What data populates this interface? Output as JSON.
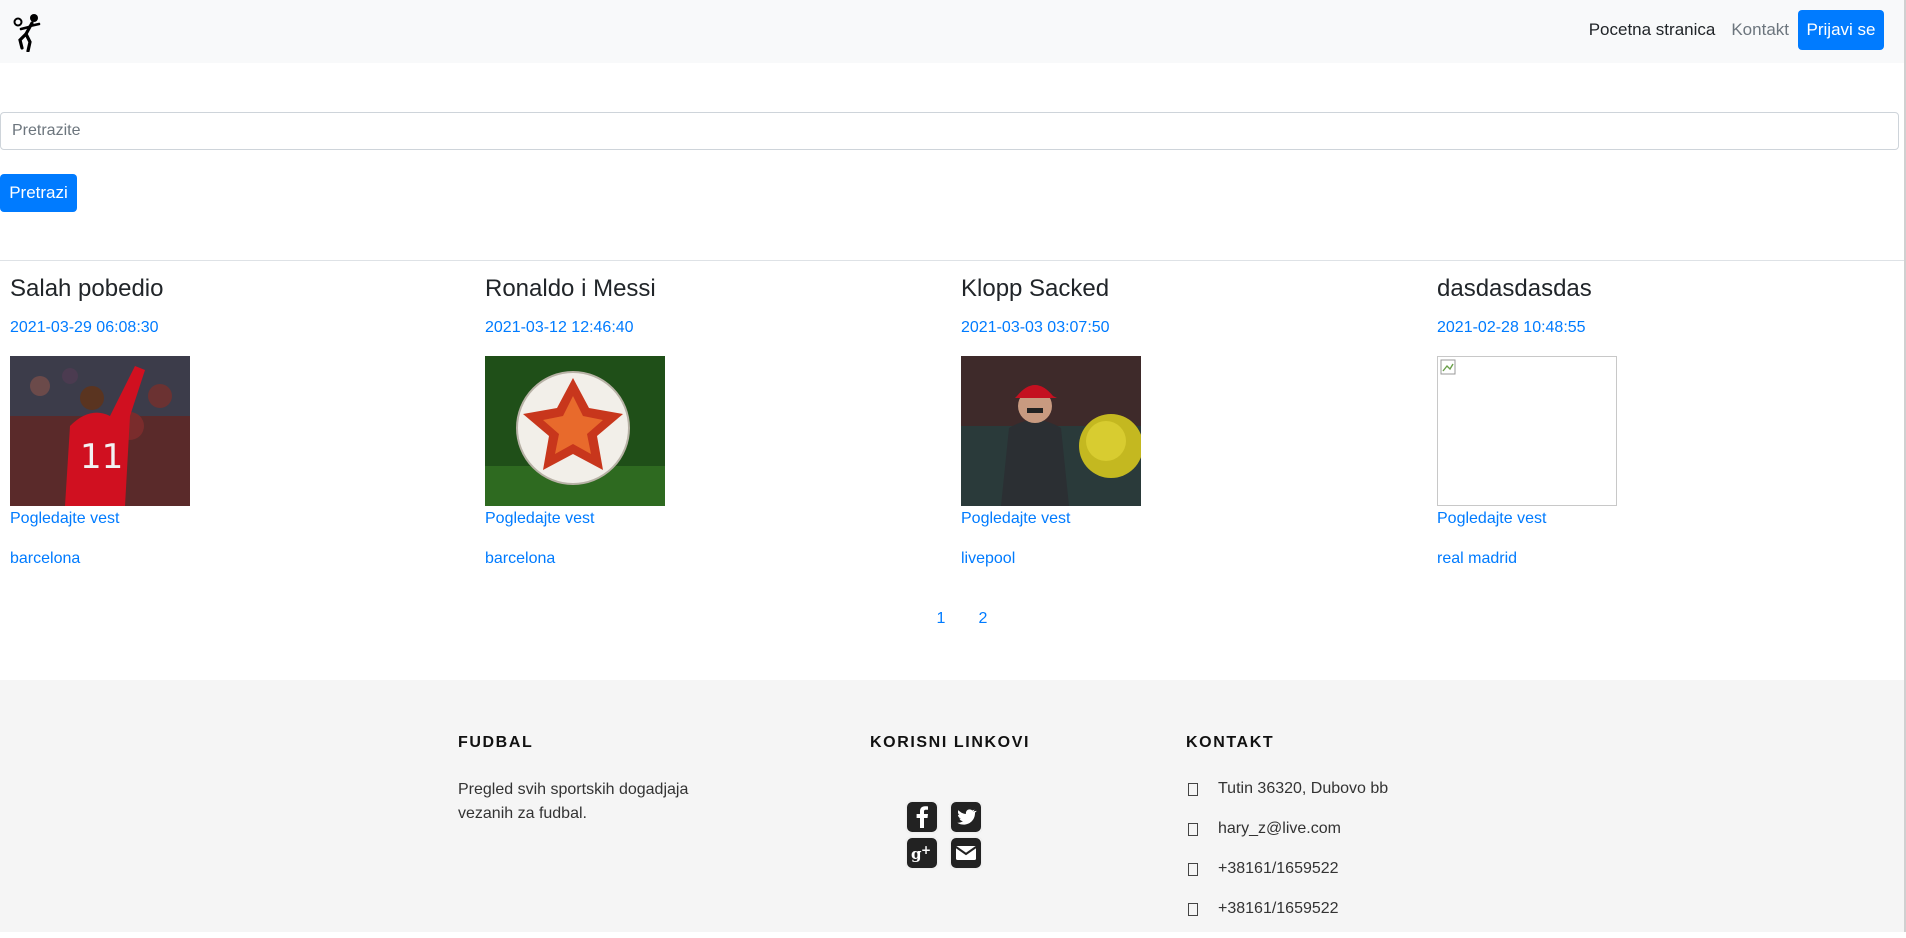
{
  "navbar": {
    "logo_icon": "football-player-icon",
    "links": {
      "home": "Pocetna stranica",
      "contact": "Kontakt"
    },
    "login_label": "Prijavi se"
  },
  "search": {
    "placeholder": "Pretrazite",
    "value": "",
    "button_label": "Pretrazi"
  },
  "articles": [
    {
      "title": "Salah pobedio",
      "date": "2021-03-29 06:08:30",
      "image": "salah-photo",
      "link_label": "Pogledajte vest",
      "tag": "barcelona"
    },
    {
      "title": "Ronaldo i Messi",
      "date": "2021-03-12 12:46:40",
      "image": "football-photo",
      "link_label": "Pogledajte vest",
      "tag": "barcelona"
    },
    {
      "title": "Klopp Sacked",
      "date": "2021-03-03 03:07:50",
      "image": "klopp-photo",
      "link_label": "Pogledajte vest",
      "tag": "livepool"
    },
    {
      "title": "dasdasdasdas",
      "date": "2021-02-28 10:48:55",
      "image": "broken-image",
      "link_label": "Pogledajte vest",
      "tag": "real madrid"
    }
  ],
  "pagination": {
    "pages": [
      "1",
      "2"
    ]
  },
  "footer": {
    "about": {
      "heading": "FUDBAL",
      "text": "Pregled svih sportskih dogadjaja vezanih za fudbal."
    },
    "links": {
      "heading": "KORISNI LINKOVI",
      "icons": [
        "facebook-icon",
        "twitter-icon",
        "google-plus-icon",
        "envelope-icon"
      ]
    },
    "contact": {
      "heading": "KONTAKT",
      "items": [
        "Tutin 36320, Dubovo bb",
        "hary_z@live.com",
        "+38161/1659522",
        "+38161/1659522"
      ]
    }
  },
  "colors": {
    "primary": "#007bff",
    "navbar_bg": "#f8f9fa",
    "footer_bg": "#f5f5f5"
  }
}
